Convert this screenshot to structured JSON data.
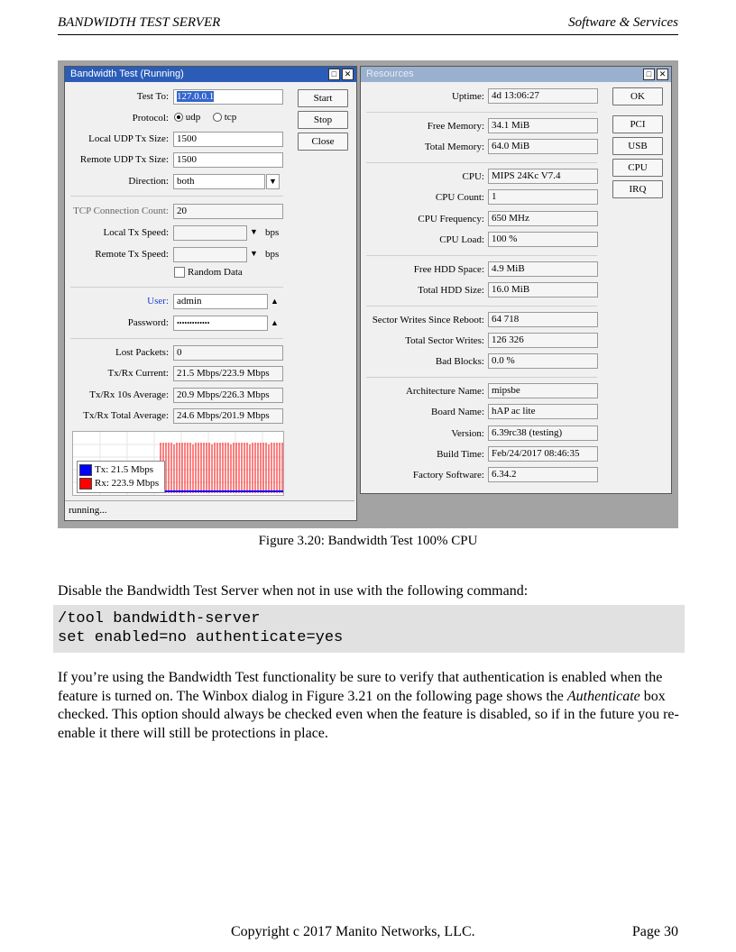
{
  "header": {
    "left": "BANDWIDTH TEST SERVER",
    "right": "Software & Services"
  },
  "bw": {
    "title": "Bandwidth Test (Running)",
    "test_to_label": "Test To:",
    "test_to": "127.0.0.1",
    "protocol_label": "Protocol:",
    "protocol_udp": "udp",
    "protocol_tcp": "tcp",
    "local_udp_label": "Local UDP Tx Size:",
    "local_udp": "1500",
    "remote_udp_label": "Remote UDP Tx Size:",
    "remote_udp": "1500",
    "direction_label": "Direction:",
    "direction": "both",
    "tcp_conn_label": "TCP Connection Count:",
    "tcp_conn": "20",
    "local_tx_label": "Local Tx Speed:",
    "remote_tx_label": "Remote Tx Speed:",
    "bps": "bps",
    "random_data": "Random Data",
    "user_label": "User:",
    "user": "admin",
    "password_label": "Password:",
    "password": "•••••••••••••",
    "lost_label": "Lost Packets:",
    "lost": "0",
    "current_label": "Tx/Rx Current:",
    "current": "21.5 Mbps/223.9 Mbps",
    "avg10_label": "Tx/Rx 10s Average:",
    "avg10": "20.9 Mbps/226.3 Mbps",
    "total_avg_label": "Tx/Rx Total Average:",
    "total_avg": "24.6 Mbps/201.9 Mbps",
    "start": "Start",
    "stop": "Stop",
    "close": "Close",
    "legend_tx": "Tx:  21.5 Mbps",
    "legend_rx": "Rx:  223.9 Mbps",
    "status": "running...",
    "tx_color": "#0000ff",
    "rx_color": "#ff0000"
  },
  "res": {
    "title": "Resources",
    "uptime_label": "Uptime:",
    "uptime": "4d 13:06:27",
    "free_mem_label": "Free Memory:",
    "free_mem": "34.1 MiB",
    "total_mem_label": "Total Memory:",
    "total_mem": "64.0 MiB",
    "cpu_label": "CPU:",
    "cpu": "MIPS 24Kc V7.4",
    "cpu_count_label": "CPU Count:",
    "cpu_count": "1",
    "cpu_freq_label": "CPU Frequency:",
    "cpu_freq": "650 MHz",
    "cpu_load_label": "CPU Load:",
    "cpu_load": "100 %",
    "free_hdd_label": "Free HDD Space:",
    "free_hdd": "4.9 MiB",
    "total_hdd_label": "Total HDD Size:",
    "total_hdd": "16.0 MiB",
    "sector_reboot_label": "Sector Writes Since Reboot:",
    "sector_reboot": "64 718",
    "sector_total_label": "Total Sector Writes:",
    "sector_total": "126 326",
    "bad_blocks_label": "Bad Blocks:",
    "bad_blocks": "0.0 %",
    "arch_label": "Architecture Name:",
    "arch": "mipsbe",
    "board_label": "Board Name:",
    "board": "hAP ac lite",
    "version_label": "Version:",
    "version": "6.39rc38 (testing)",
    "build_label": "Build Time:",
    "build": "Feb/24/2017 08:46:35",
    "factory_label": "Factory Software:",
    "factory": "6.34.2",
    "ok": "OK",
    "pci": "PCI",
    "usb": "USB",
    "cpu_btn": "CPU",
    "irq": "IRQ"
  },
  "caption": "Figure 3.20: Bandwidth Test 100% CPU",
  "para1": "Disable the Bandwidth Test Server when not in use with the following command:",
  "code": {
    "line1": "/tool bandwidth-server",
    "line2": "set enabled=no authenticate=yes"
  },
  "para2": {
    "a": "If you’re using the Bandwidth Test functionality be sure to verify that authentication is enabled when the feature is turned on.    The Winbox dialog in Figure 3.21 on the following page shows the ",
    "em": "Authenticate",
    "b": " box checked.    This option should always be checked even when the feature is disabled, so if in the future you re-enable it there will still be protections in place."
  },
  "footer": {
    "copyright": "Copyright  c  2017 Manito Networks, LLC.",
    "page": "Page 30"
  }
}
